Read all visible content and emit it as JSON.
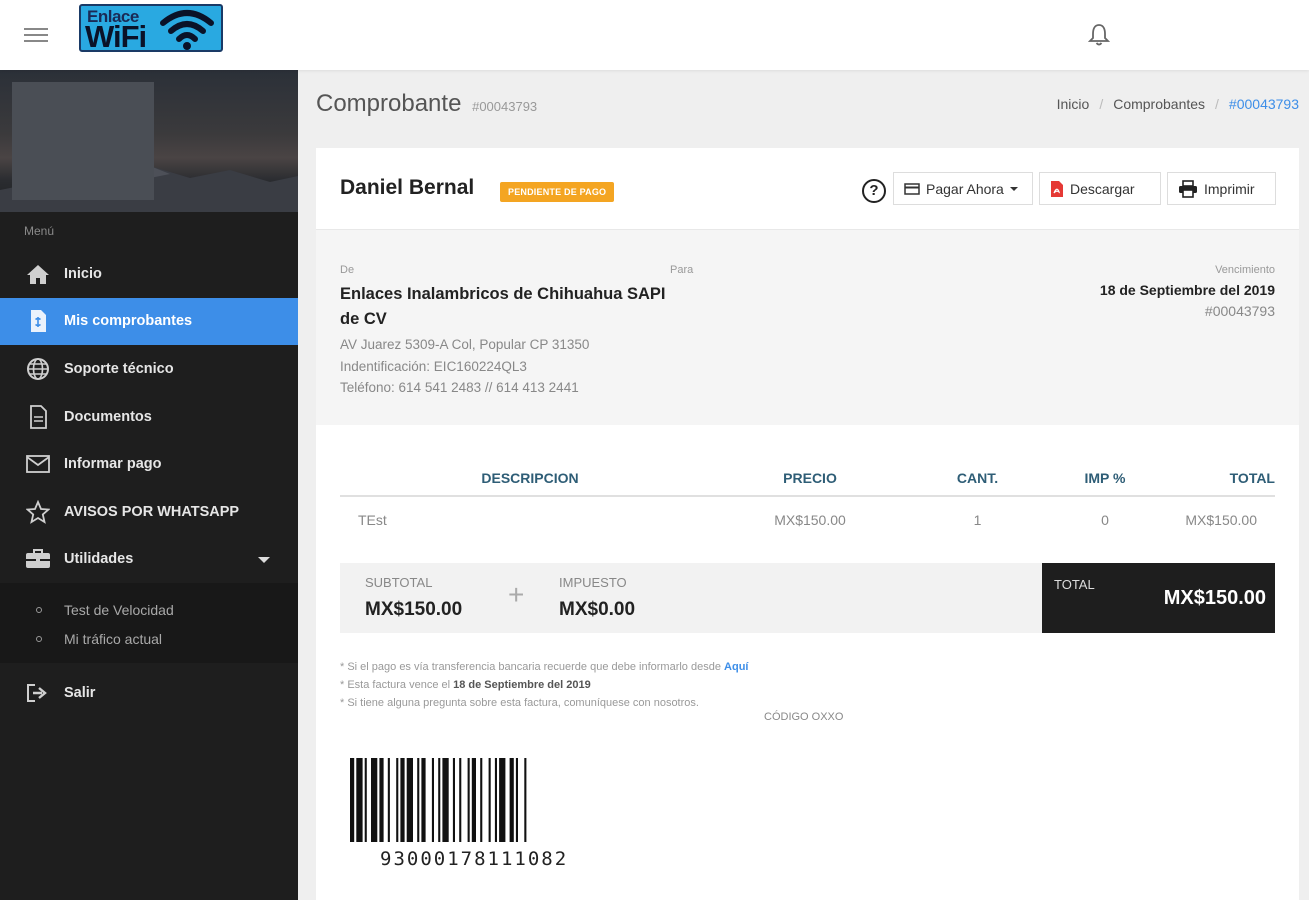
{
  "header": {
    "logo": {
      "line1": "Enlace",
      "line2": "WiFi"
    },
    "icons": {
      "menu": "hamburger-icon",
      "notifications": "bell-icon"
    }
  },
  "sidebar": {
    "menu_label": "Menú",
    "items": [
      {
        "label": "Inicio",
        "icon": "home-icon",
        "active": false
      },
      {
        "label": "Mis comprobantes",
        "icon": "file-icon",
        "active": true
      },
      {
        "label": "Soporte técnico",
        "icon": "globe-icon",
        "active": false
      },
      {
        "label": "Documentos",
        "icon": "document-icon",
        "active": false
      },
      {
        "label": "Informar pago",
        "icon": "envelope-icon",
        "active": false
      },
      {
        "label": "AVISOS POR WHATSAPP",
        "icon": "star-icon",
        "active": false
      },
      {
        "label": "Utilidades",
        "icon": "toolbox-icon",
        "active": false,
        "expanded": true
      }
    ],
    "subitems": [
      {
        "label": "Test de Velocidad"
      },
      {
        "label": "Mi tráfico actual"
      }
    ],
    "logout": {
      "label": "Salir",
      "icon": "sign-out-icon"
    }
  },
  "page": {
    "title": "Comprobante",
    "number": "#00043793",
    "breadcrumb": [
      "Inicio",
      "Comprobantes",
      "#00043793"
    ]
  },
  "invoice": {
    "client_name": "Daniel Bernal",
    "status": "PENDIENTE DE PAGO",
    "status_color": "#f4a522",
    "buttons": {
      "pay": "Pagar Ahora",
      "download": "Descargar",
      "print": "Imprimir"
    },
    "from_label": "De",
    "to_label": "Para",
    "due_label": "Vencimiento",
    "from_name": "Enlaces Inalambricos de Chihuahua SAPI de CV",
    "from_address": "AV Juarez 5309-A Col, Popular CP 31350",
    "from_id": "Indentificación: EIC160224QL3",
    "from_phone": "Teléfono: 614 541 2483 // 614 413 2441",
    "due_date": "18 de Septiembre del 2019",
    "due_number": "#00043793",
    "table": {
      "headers": [
        "DESCRIPCION",
        "PRECIO",
        "CANT.",
        "IMP %",
        "TOTAL"
      ],
      "rows": [
        [
          "TEst",
          "MX$150.00",
          "1",
          "0",
          "MX$150.00"
        ]
      ]
    },
    "subtotal_label": "SUBTOTAL",
    "subtotal": "MX$150.00",
    "tax_label": "IMPUESTO",
    "tax": "MX$0.00",
    "total_label": "TOTAL",
    "total": "MX$150.00",
    "notes": {
      "n1": "* Si el pago es vía transferencia bancaria recuerde que debe informarlo desde",
      "n1_link": "Aquí",
      "n2": "* Esta factura vence el",
      "n2_bold": "18 de Septiembre del 2019",
      "n3": "* Si tiene alguna pregunta sobre esta factura, comuníquese con nosotros."
    },
    "code_label": "CÓDIGO OXXO",
    "barcode_number": "93000178111082"
  },
  "colors": {
    "accent": "#3d8ee8",
    "sidebar_bg": "#1e1e1e",
    "header_th": "#2e5d76"
  }
}
